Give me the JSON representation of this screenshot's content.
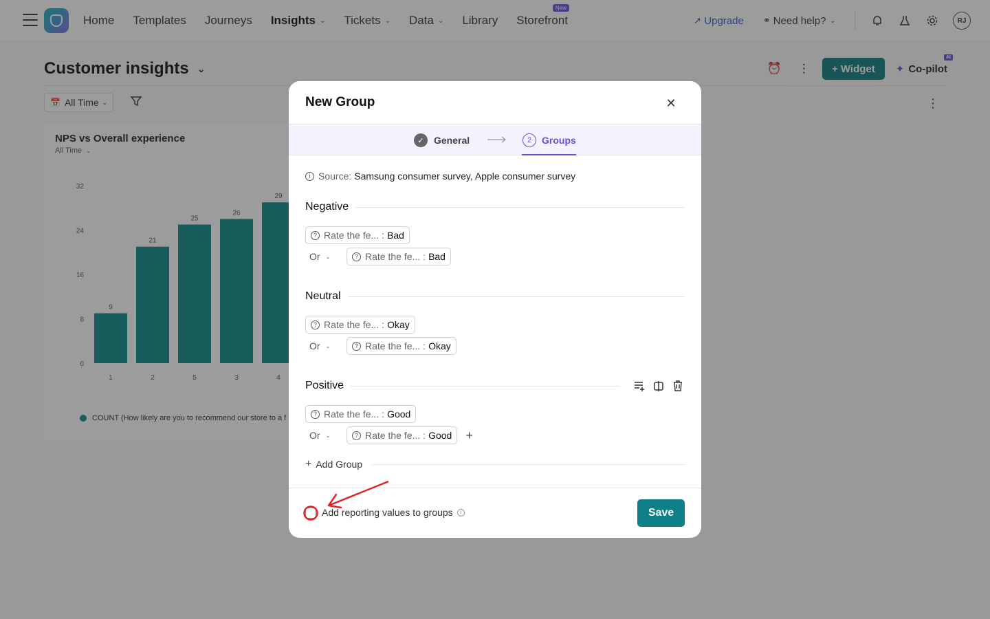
{
  "nav": {
    "items": [
      {
        "label": "Home",
        "active": false,
        "dropdown": false
      },
      {
        "label": "Templates",
        "active": false,
        "dropdown": false
      },
      {
        "label": "Journeys",
        "active": false,
        "dropdown": false
      },
      {
        "label": "Insights",
        "active": true,
        "dropdown": true
      },
      {
        "label": "Tickets",
        "active": false,
        "dropdown": true
      },
      {
        "label": "Data",
        "active": false,
        "dropdown": true
      },
      {
        "label": "Library",
        "active": false,
        "dropdown": false
      },
      {
        "label": "Storefront",
        "active": false,
        "dropdown": false,
        "badge": "New"
      }
    ],
    "upgrade": "Upgrade",
    "help": "Need help?",
    "avatar": "RJ"
  },
  "page": {
    "title": "Customer insights",
    "widget_button": "+ Widget",
    "copilot": "Co-pilot",
    "copilot_badge": "AI",
    "filter_alltime": "All Time"
  },
  "card": {
    "title": "NPS vs Overall experience",
    "subtitle": "All Time",
    "legend": "COUNT (How likely are you to recommend our store to a f"
  },
  "chart_data": {
    "type": "bar",
    "categories": [
      "1",
      "2",
      "5",
      "3",
      "4"
    ],
    "values": [
      9,
      21,
      25,
      26,
      29
    ],
    "yticks": [
      0,
      8,
      16,
      24,
      32
    ],
    "ylim": [
      0,
      32
    ],
    "color": "#0e8a8a",
    "series": [
      {
        "name": "COUNT (How likely are you to recommend our store to a f",
        "values": [
          9,
          21,
          25,
          26,
          29
        ]
      }
    ]
  },
  "modal": {
    "title": "New Group",
    "steps": [
      {
        "label": "General",
        "state": "done"
      },
      {
        "label": "Groups",
        "number": "2",
        "state": "active"
      }
    ],
    "source_label": "Source:",
    "source_value": "Samsung consumer survey, Apple consumer survey",
    "groups": [
      {
        "name": "Negative",
        "conditions": [
          {
            "field": "Rate the fe...",
            "value": "Bad"
          },
          {
            "connector": "Or",
            "field": "Rate the fe...",
            "value": "Bad"
          }
        ]
      },
      {
        "name": "Neutral",
        "conditions": [
          {
            "field": "Rate the fe...",
            "value": "Okay"
          },
          {
            "connector": "Or",
            "field": "Rate the fe...",
            "value": "Okay"
          }
        ]
      },
      {
        "name": "Positive",
        "conditions": [
          {
            "field": "Rate the fe...",
            "value": "Good"
          },
          {
            "connector": "Or",
            "field": "Rate the fe...",
            "value": "Good"
          }
        ]
      }
    ],
    "add_group": "Add Group",
    "checkbox_label": "Add reporting values to groups",
    "checkbox_checked": false,
    "save": "Save"
  },
  "colors": {
    "accent": "#0e7f86",
    "step_active": "#6a4fd6",
    "annotation": "#e02424"
  }
}
